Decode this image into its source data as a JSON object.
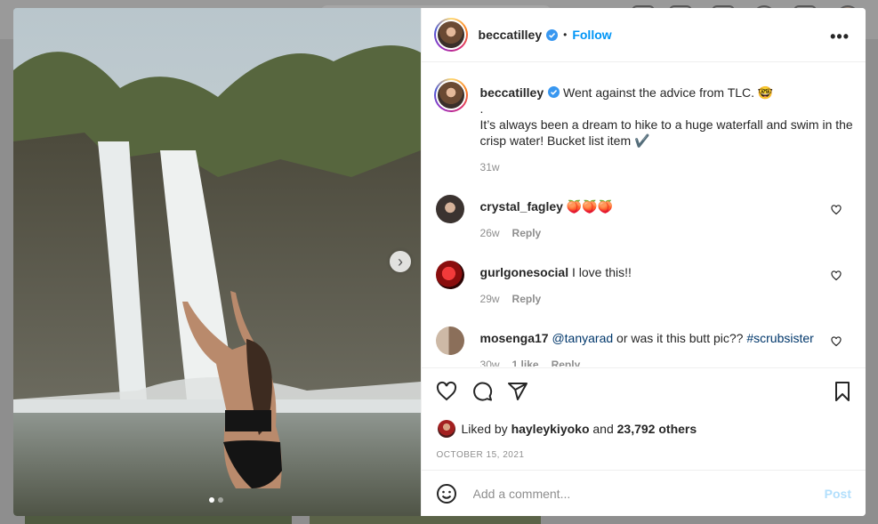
{
  "post": {
    "username": "beccatilley",
    "follow_label": "Follow",
    "separator": "•",
    "more_label": "•••"
  },
  "caption": {
    "username": "beccatilley",
    "line1": "Went against the advice from TLC. 🤓",
    "line2": ".",
    "line3": "It’s always been a dream to hike to a huge waterfall and swim in the crisp water! Bucket list item ✔️",
    "time": "31w"
  },
  "comments": [
    {
      "username": "crystal_fagley",
      "text": "🍑🍑🍑",
      "time": "26w",
      "likes": "",
      "reply_label": "Reply"
    },
    {
      "username": "gurlgonesocial",
      "text": "I love this!!",
      "time": "29w",
      "likes": "",
      "reply_label": "Reply"
    },
    {
      "username": "mosenga17",
      "mention": "@tanyarad",
      "text": "or was it this butt pic??",
      "hashtag": "#scrubsister",
      "time": "30w",
      "likes": "1 like",
      "reply_label": "Reply"
    }
  ],
  "likes": {
    "prefix": "Liked by",
    "user": "hayleykiyoko",
    "middle": "and",
    "count": "23,792 others"
  },
  "date": "OCTOBER 15, 2021",
  "add_comment": {
    "placeholder": "Add a comment...",
    "post_label": "Post"
  },
  "carousel": {
    "current": 1,
    "total": 2
  },
  "colors": {
    "follow": "#0095f6",
    "post_disabled": "#b2dffc",
    "link": "#00376b",
    "verified": "#3897f0"
  },
  "icons": [
    "like-icon",
    "comment-icon",
    "share-icon",
    "bookmark-icon",
    "emoji-icon",
    "verified-icon",
    "more-icon",
    "chevron-right-icon"
  ]
}
